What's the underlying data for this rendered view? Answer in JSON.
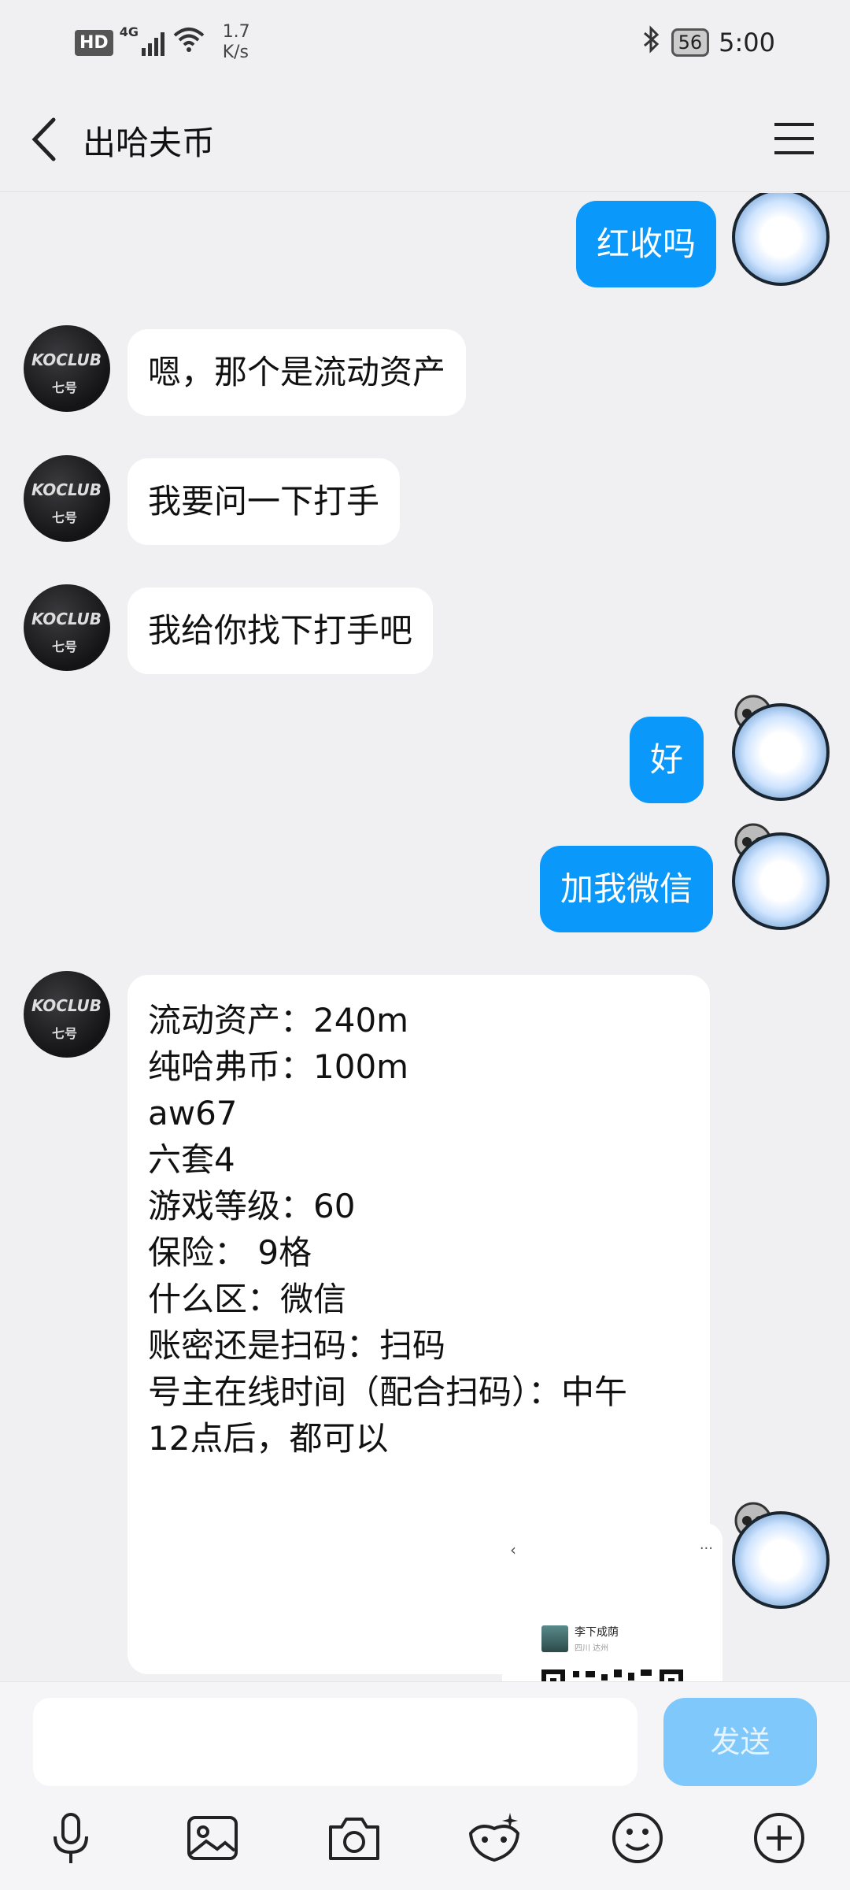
{
  "status_bar": {
    "hd": "HD",
    "network": "4G",
    "speed_value": "1.7",
    "speed_unit": "K/s",
    "battery": "56",
    "time": "5:00"
  },
  "header": {
    "title": "出哈夫币"
  },
  "messages": [
    {
      "side": "out",
      "text": "红收吗"
    },
    {
      "side": "in",
      "text": "嗯，那个是流动资产"
    },
    {
      "side": "in",
      "text": "我要问一下打手"
    },
    {
      "side": "in",
      "text": "我给你找下打手吧"
    },
    {
      "side": "out",
      "text": "好"
    },
    {
      "side": "out",
      "text": "加我微信"
    },
    {
      "side": "in",
      "lines": [
        "流动资产：240m",
        "纯哈弗币：100m",
        "aw67",
        "六套4",
        "游戏等级：60",
        "保险： 9格",
        "什么区：微信",
        "账密还是扫码：扫码",
        "号主在线时间（配合扫码）：中午",
        "12点后，都可以"
      ]
    },
    {
      "side": "out",
      "card_name": "李下成荫",
      "card_sub": "四川 达州",
      "card_more": "···"
    }
  ],
  "avatar_in_text": {
    "top": "KOCLUB",
    "bottom": "七号"
  },
  "input": {
    "placeholder": "",
    "send_label": "发送"
  },
  "toolbar_icons": [
    "microphone-icon",
    "image-icon",
    "camera-icon",
    "sticker-icon",
    "emoji-icon",
    "plus-icon"
  ],
  "colors": {
    "outgoing_bubble": "#0a98fb",
    "incoming_bubble": "#ffffff",
    "background": "#f0f0f3",
    "send_button": "#7fc8fb"
  }
}
